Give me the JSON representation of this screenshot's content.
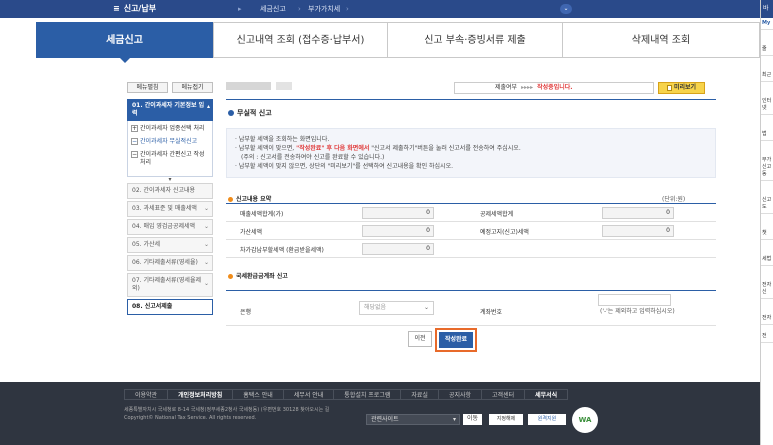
{
  "topbar": {
    "home_label": "신고/납부",
    "crumb1": "세금신고",
    "crumb2": "부가가치세"
  },
  "tabs": [
    {
      "label": "세금신고",
      "active": true
    },
    {
      "label": "신고내역 조회 (접수증·납부서)",
      "active": false
    },
    {
      "label": "신고 부속·증빙서류 제출",
      "active": false
    },
    {
      "label": "삭제내역 조회",
      "active": false
    }
  ],
  "sidebar": {
    "expand_label": "메뉴펼침",
    "collapse_label": "메뉴접기",
    "head": "01. 간이과세자 기본정보 입력",
    "sub_items": [
      {
        "box": "+",
        "label": "간이과세자 업종선택 처리"
      },
      {
        "box": "−",
        "label": "간이과세자 무실적신고"
      },
      {
        "box": "−",
        "label": "간이과세자 간편신고 작성 처리"
      }
    ],
    "items": [
      "02. 간이과세자 신고내용",
      "03. 과세표준 및 매출세액",
      "04. 매입 영검금공제세액",
      "05. 가산세",
      "06. 기타제출서류(영세율)",
      "07. 기타제출서류(영세율제외)",
      "08. 신고서제출"
    ]
  },
  "main": {
    "status_prefix": "제출여부",
    "status_arrows": "▸▸▸▸",
    "status_value": "작성중",
    "status_suffix": "입니다.",
    "preview_label": "미리보기",
    "section_title": "무실적 신고",
    "notice_line1": "· 납부할 세액을 조회하는 화면입니다.",
    "notice_line2a": "· 납부할 세액이 맞으면, ",
    "notice_line2b": "\"작성완료\" 후 다음 화면에서",
    "notice_line2c": " \"신고서 제출하기\"버튼을 눌러 신고서를 전송하여 주십시오.",
    "notice_line3": "(주의 : 신고서를 전송하여야 신고를 완료할 수 있습니다.)",
    "notice_line4": "· 납부할 세액이 맞지 않으면, 상단의 \"미리보기\"를 선택하여 신고내용을 확인 하십시오.",
    "summary_title": "신고내용 요약",
    "unit": "(단위:원)",
    "rows": [
      {
        "l1": "매출세액합계(가)",
        "v1": "0",
        "l2": "공제세액합계",
        "v2": "0"
      },
      {
        "l1": "가산세액",
        "v1": "0",
        "l2": "예정고지(신고)세액",
        "v2": "0"
      },
      {
        "l1": "차가감납부할세액 (환급받을세액)",
        "v1": "0",
        "l2": "",
        "v2": ""
      }
    ],
    "refund_title": "국세환급금계좌 신고",
    "bank_label": "은행",
    "bank_placeholder": "해당없음",
    "account_label": "계좌번호",
    "account_hint": "('-'는 제외하고 입력하십시오)",
    "prev_label": "이전",
    "done_label": "작성완료"
  },
  "footer": {
    "links": [
      "이용약관",
      "개인정보처리방침",
      "홈택스 안내",
      "세무서 안내",
      "통합설치 프로그램",
      "자료실",
      "공지사항",
      "고객센터",
      "세무서식"
    ],
    "addr": "세종특별자치시 국세청로 8-14 국세청(정부세종2청사 국세청동) (우편번호 30128  찾아오시는 길",
    "copyright": "Copyright© National Tax Service. All rights reserved.",
    "related_label": "관련사이트",
    "go_label": "이동",
    "btn1": "지정해제",
    "btn2": "원격지원",
    "wa_label": "WA"
  },
  "right_panel": {
    "top": "바로",
    "items": [
      "My",
      "줄",
      "최근",
      "인터넷",
      "법",
      "부가 신고 동",
      "신고도",
      "챗",
      "세법",
      "전자신",
      "전자",
      "전"
    ]
  }
}
